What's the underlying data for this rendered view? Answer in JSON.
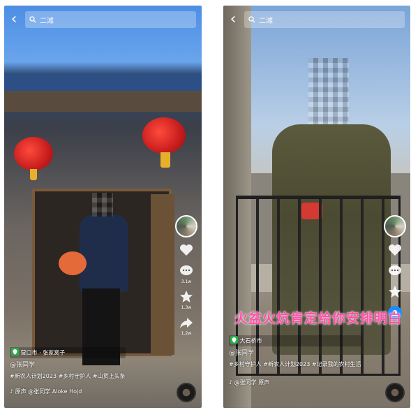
{
  "screens": [
    {
      "search_placeholder": "二滩",
      "location": "营口市 · 张家窝子",
      "username": "@张同学",
      "hashtags": "#新农人计划2023 #乡村守护人 #山货上头条",
      "music": "原声 @张同学  Aloke Hojd",
      "like_count": "",
      "comment_count": "3.1w",
      "favorite_count": "1.3w",
      "share_count": "1.2w"
    },
    {
      "search_placeholder": "二滩",
      "location": "大石桥市",
      "username": "@张同学",
      "hashtags": "#乡村守护人 #新农人计划2023 #记录我的农村生活",
      "music": "@张同学  原声",
      "caption": "火盆火炕肯定给你安排明白",
      "like_count": "",
      "comment_count": "",
      "favorite_count": "",
      "share_count": ""
    }
  ],
  "icons": {
    "back": "chevron-left-icon",
    "search": "search-icon",
    "like": "heart-icon",
    "comment": "comment-icon",
    "favorite": "star-icon",
    "share": "share-icon",
    "location": "location-pin-icon",
    "music": "music-note-icon"
  },
  "colors": {
    "caption": "#ff4fa6",
    "location_pin": "#22b04b",
    "follow_button": "#1a8cff"
  }
}
